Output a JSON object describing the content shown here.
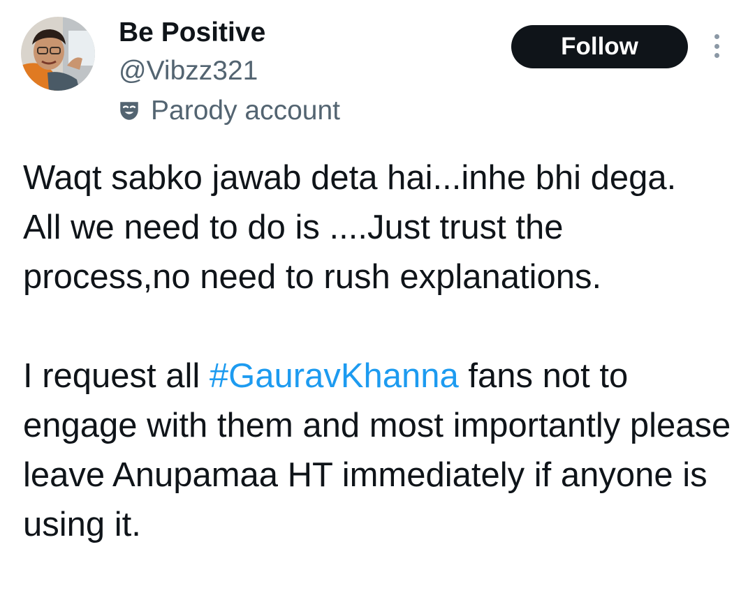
{
  "user": {
    "display_name": "Be Positive",
    "handle": "@Vibzz321",
    "label": "Parody account",
    "label_icon": "parody-mask-icon",
    "avatar_icon": "profile-photo"
  },
  "actions": {
    "follow_label": "Follow",
    "more_icon": "vertical-ellipsis-icon"
  },
  "tweet": {
    "line1": "Waqt sabko jawab deta hai...inhe bhi dega.",
    "line2": "All we need to do is ....Just trust the process,no need to rush explanations.",
    "para2_before": "I request all ",
    "hashtag": "#GauravKhanna",
    "para2_after": " fans not to engage with them and most importantly please leave Anupamaa HT immediately if anyone is using it."
  },
  "colors": {
    "text": "#0f1419",
    "secondary": "#536471",
    "link": "#1d9bf0",
    "button_bg": "#0f1419",
    "button_text": "#ffffff"
  }
}
